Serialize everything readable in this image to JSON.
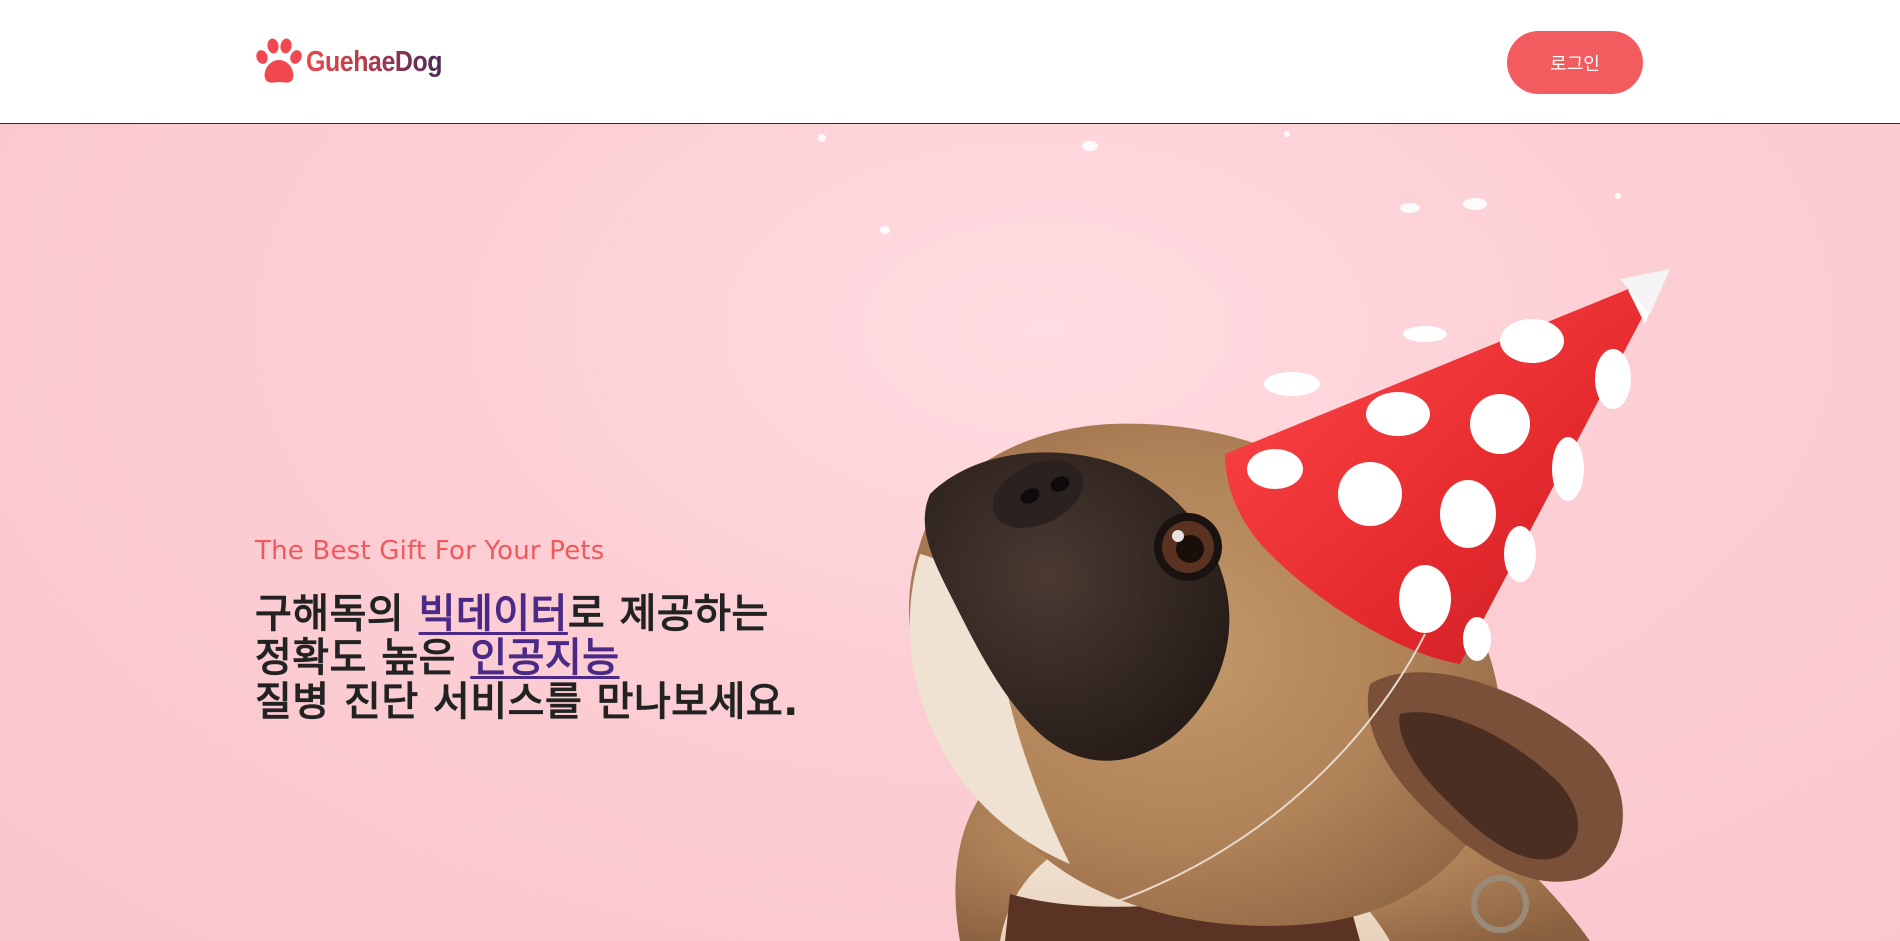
{
  "header": {
    "logo_text": "GuehaeDog",
    "login_label": "로그인"
  },
  "hero": {
    "tagline": "The Best Gift For Your Pets",
    "headline": {
      "line1_prefix": "구해독의 ",
      "line1_link": "빅데이터",
      "line1_suffix": "로 제공하는",
      "line2_prefix": "정확도 높은 ",
      "line2_link": "인공지능",
      "line3": "질병 진단 서비스를 만나보세요."
    },
    "image": "pug-with-party-hat"
  },
  "colors": {
    "accent": "#f25c5e",
    "link": "#4a2a86",
    "hero_background": "#fccfd5"
  }
}
